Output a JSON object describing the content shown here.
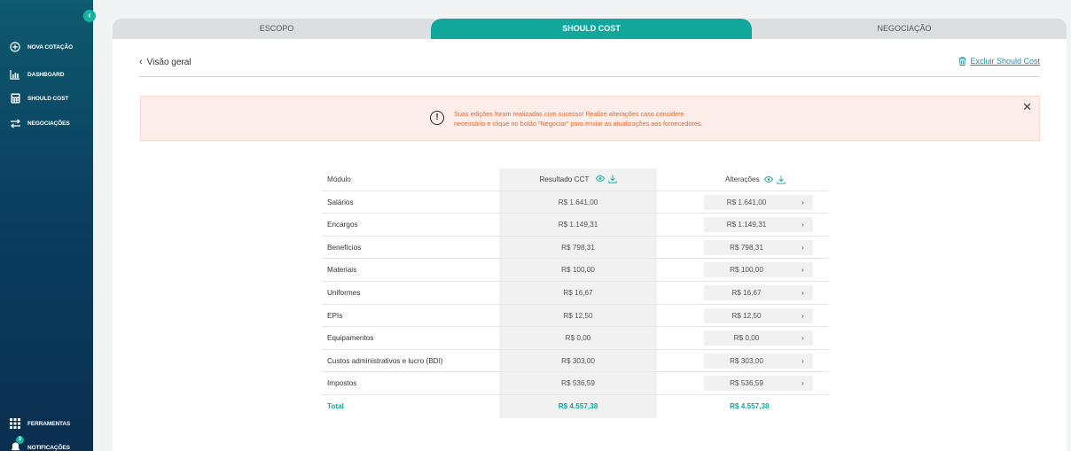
{
  "sidebar": {
    "items": [
      {
        "label": "NOVA COTAÇÃO",
        "icon": "plus-circle-icon"
      },
      {
        "label": "DASHBOARD",
        "icon": "bar-chart-icon"
      },
      {
        "label": "SHOULD COST",
        "icon": "calculator-icon"
      },
      {
        "label": "NEGOCIAÇÕES",
        "icon": "swap-arrows-icon"
      }
    ],
    "bottom": [
      {
        "label": "FERRAMENTAS",
        "icon": "grid-icon"
      },
      {
        "label": "NOTIFICAÇÕES",
        "icon": "bell-icon",
        "badge": "2"
      }
    ],
    "collapse_glyph": "‹"
  },
  "tabs": [
    {
      "label": "ESCOPO"
    },
    {
      "label": "SHOULD COST"
    },
    {
      "label": "NEGOCIAÇÃO"
    }
  ],
  "header": {
    "back_label": "Visão geral",
    "delete_label": "Excluir Should Cost"
  },
  "alert": {
    "line1": "Suas edições foram realizadas com sucesso! Realize alterações caso considere",
    "line2": "necessário e clique no botão \"Negociar\" para enviar as atualizações aos fornecedores.",
    "close_glyph": "✕",
    "icon_glyph": "!"
  },
  "table": {
    "col_module": "Módulo",
    "col_result": "Resultado CCT",
    "col_changes": "Alterações",
    "rows": [
      {
        "label": "Salários",
        "result": "R$ 1.641,00",
        "change": "R$ 1.641,00"
      },
      {
        "label": "Encargos",
        "result": "R$ 1.149,31",
        "change": "R$ 1.149,31"
      },
      {
        "label": "Benefícios",
        "result": "R$ 798,31",
        "change": "R$ 798,31"
      },
      {
        "label": "Materiais",
        "result": "R$ 100,00",
        "change": "R$ 100,00"
      },
      {
        "label": "Uniformes",
        "result": "R$ 16,67",
        "change": "R$ 16,67"
      },
      {
        "label": "EPIs",
        "result": "R$ 12,50",
        "change": "R$ 12,50"
      },
      {
        "label": "Equipamentos",
        "result": "R$ 0,00",
        "change": "R$ 0,00"
      },
      {
        "label": "Custos administrativos e lucro (BDI)",
        "result": "R$ 303,00",
        "change": "R$ 303,00"
      },
      {
        "label": "Impostos",
        "result": "R$ 536,59",
        "change": "R$ 536,59"
      }
    ],
    "total": {
      "label": "Total",
      "result": "R$ 4.557,38",
      "change": "R$ 4.557,38"
    }
  },
  "colors": {
    "accent": "#11a79a",
    "alert_text": "#e8622a",
    "alert_bg": "#fdeee9",
    "sidebar_top": "#0e5a6e",
    "sidebar_bottom": "#0a2e4f"
  }
}
